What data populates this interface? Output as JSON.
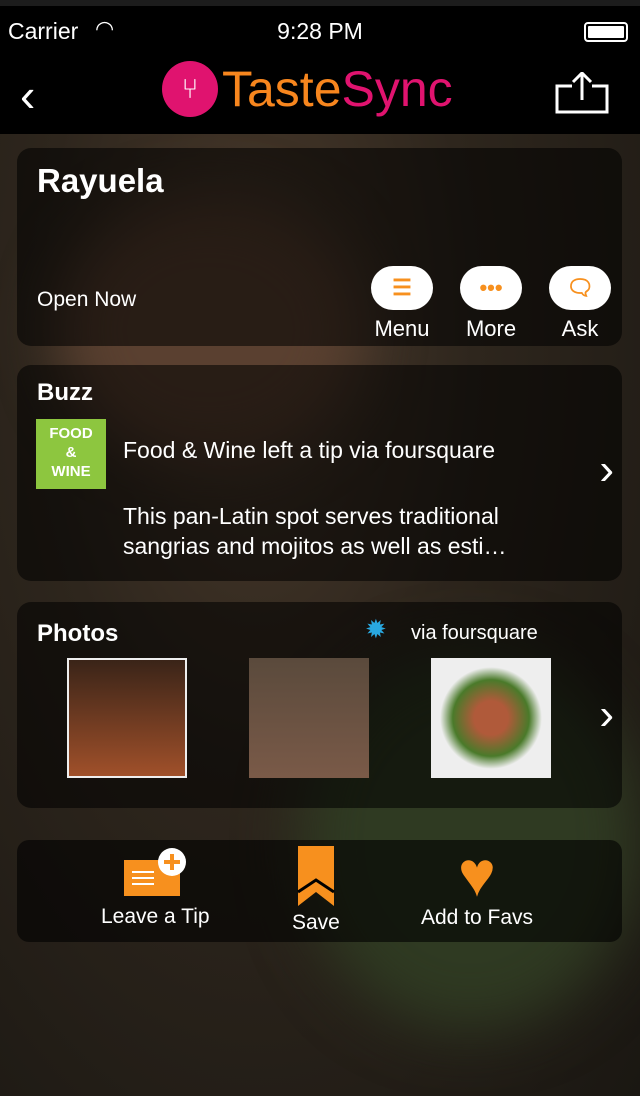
{
  "status": {
    "carrier": "Carrier",
    "time": "9:28 PM"
  },
  "nav": {
    "logo_part1": "Taste",
    "logo_part2": "Sync"
  },
  "restaurant": {
    "name": "Rayuela",
    "status": "Open Now",
    "actions": [
      {
        "label": "Menu"
      },
      {
        "label": "More"
      },
      {
        "label": "Ask"
      }
    ]
  },
  "buzz": {
    "heading": "Buzz",
    "source_logo": "FOOD & WINE",
    "source_line": "Food & Wine  left a tip via foursquare",
    "tip": "This pan-Latin spot serves traditional sangrias and mojitos as well as esti…"
  },
  "photos": {
    "heading": "Photos",
    "source": "via foursquare"
  },
  "bottom": {
    "leave_tip": "Leave a Tip",
    "save": "Save",
    "favs": "Add to Favs"
  },
  "colors": {
    "accent": "#f7901e",
    "brand_pink": "#e0136f"
  }
}
